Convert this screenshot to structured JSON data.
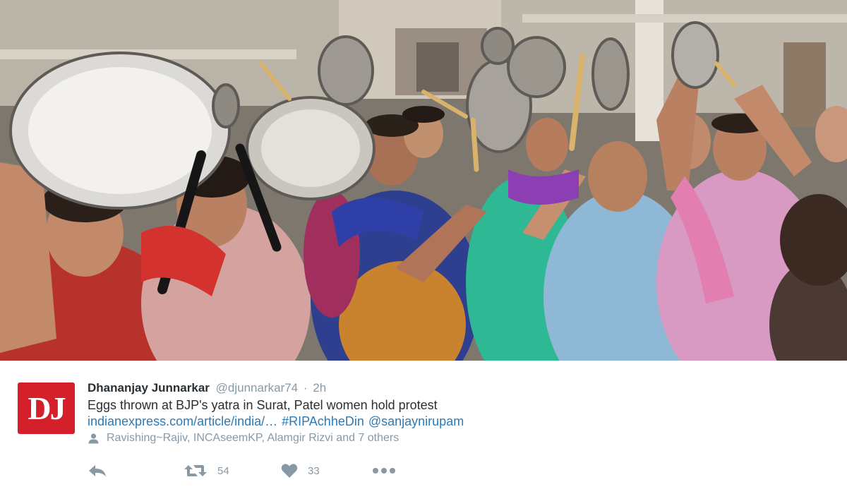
{
  "photo": {
    "alt_icon": "news-photo"
  },
  "tweet": {
    "avatar_text": "DJ",
    "avatar_color": "#d4202a",
    "display_name": "Dhananjay Junnarkar",
    "screen_name": "@djunnarkar74",
    "separator": "·",
    "time": "2h",
    "text": "Eggs thrown at BJP's yatra in Surat, Patel women hold protest",
    "link_url": "indianexpress.com/article/india/…",
    "hashtag": "#RIPAchheDin",
    "mention": "@sanjaynirupam",
    "context_icon": "person-icon",
    "context_text": "Ravishing~Rajiv, INCAseemKP, Alamgir Rizvi and 7 others",
    "link_color": "#2b7bb9",
    "muted_color": "#8899a6"
  },
  "actions": {
    "reply_icon": "reply-icon",
    "retweet_icon": "retweet-icon",
    "retweet_count": "54",
    "like_icon": "heart-icon",
    "like_count": "33",
    "more_icon": "more-icon"
  }
}
